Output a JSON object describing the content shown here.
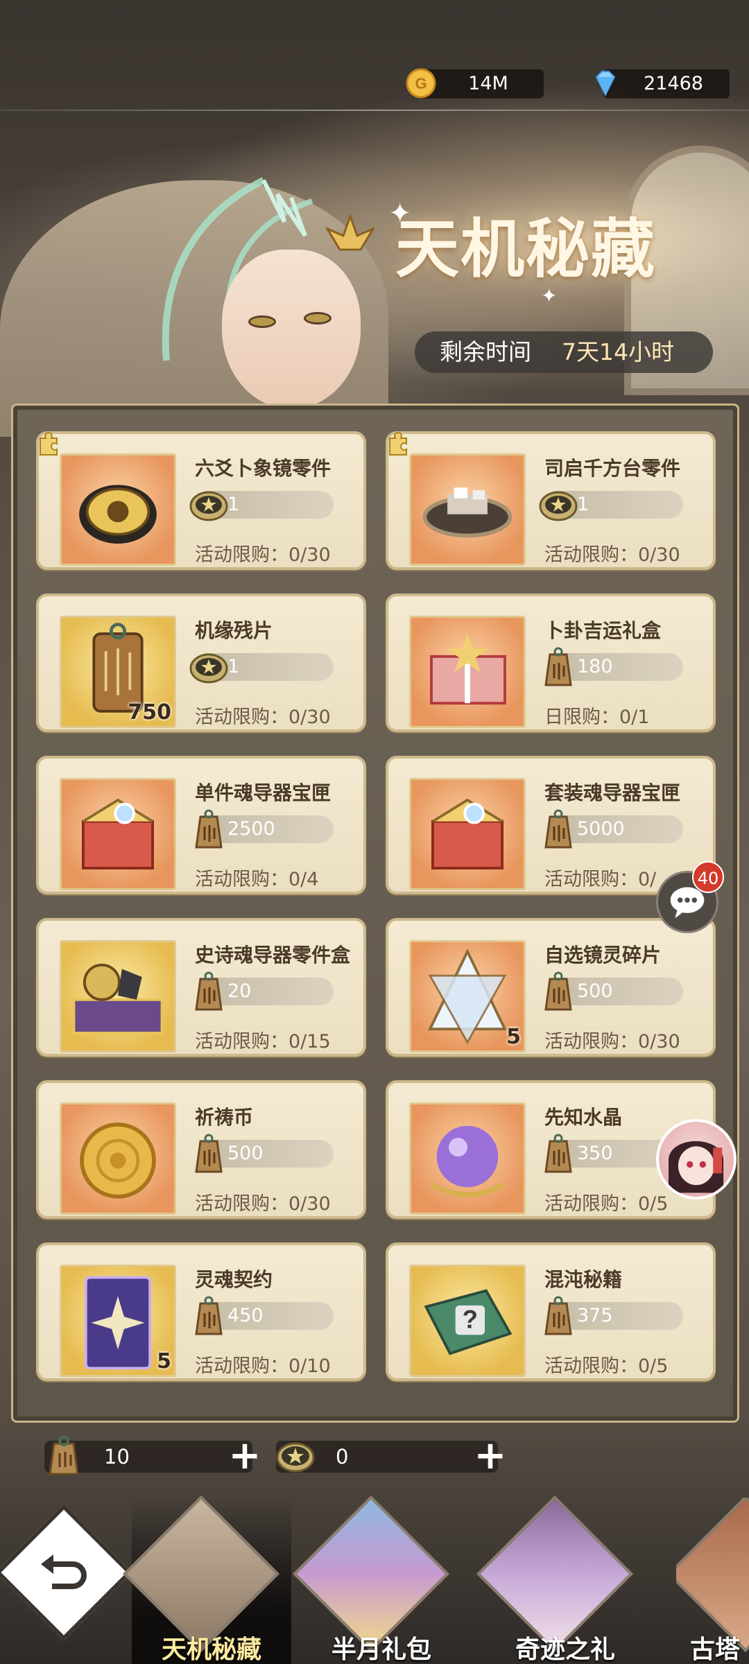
{
  "currency": {
    "gold": {
      "icon": "gold-coin-icon",
      "value": "14M"
    },
    "gems": {
      "icon": "diamond-icon",
      "value": "21468"
    }
  },
  "banner": {
    "title": "天机秘藏",
    "timer_label": "剩余时间",
    "timer_value": "7天14小时"
  },
  "items": [
    {
      "name": "六爻卜象镜零件",
      "price": "1",
      "currency": "star-coin",
      "limit": "活动限购：0/30",
      "qty": ""
    },
    {
      "name": "司启千方台零件",
      "price": "1",
      "currency": "star-coin",
      "limit": "活动限购：0/30",
      "qty": ""
    },
    {
      "name": "机缘残片",
      "price": "1",
      "currency": "star-coin",
      "limit": "活动限购：0/30",
      "qty": "750"
    },
    {
      "name": "卜卦吉运礼盒",
      "price": "180",
      "currency": "tag-token",
      "limit": "日限购：0/1",
      "qty": ""
    },
    {
      "name": "单件魂导器宝匣",
      "price": "2500",
      "currency": "tag-token",
      "limit": "活动限购：0/4",
      "qty": ""
    },
    {
      "name": "套装魂导器宝匣",
      "price": "5000",
      "currency": "tag-token",
      "limit": "活动限购：0/",
      "qty": ""
    },
    {
      "name": "史诗魂导器零件盒",
      "price": "20",
      "currency": "tag-token",
      "limit": "活动限购：0/15",
      "qty": ""
    },
    {
      "name": "自选镜灵碎片",
      "price": "500",
      "currency": "tag-token",
      "limit": "活动限购：0/30",
      "qty": "5"
    },
    {
      "name": "祈祷币",
      "price": "500",
      "currency": "tag-token",
      "limit": "活动限购：0/30",
      "qty": ""
    },
    {
      "name": "先知水晶",
      "price": "350",
      "currency": "tag-token",
      "limit": "活动限购：0/5",
      "qty": ""
    },
    {
      "name": "灵魂契约",
      "price": "450",
      "currency": "tag-token",
      "limit": "活动限购：0/10",
      "qty": "5"
    },
    {
      "name": "混沌秘籍",
      "price": "375",
      "currency": "tag-token",
      "limit": "活动限购：0/5",
      "qty": ""
    }
  ],
  "wallet": {
    "tag_tokens": "10",
    "star_coins": "0"
  },
  "chat": {
    "badge": "40"
  },
  "tabs": [
    {
      "label": "天机秘藏",
      "active": true
    },
    {
      "label": "半月礼包",
      "active": false
    },
    {
      "label": "奇迹之礼",
      "active": false
    },
    {
      "label": "古塔",
      "active": false
    }
  ],
  "colors": {
    "accent": "#ffe9a0",
    "card_bg": "#f4ead2",
    "badge": "#d43a2a"
  }
}
